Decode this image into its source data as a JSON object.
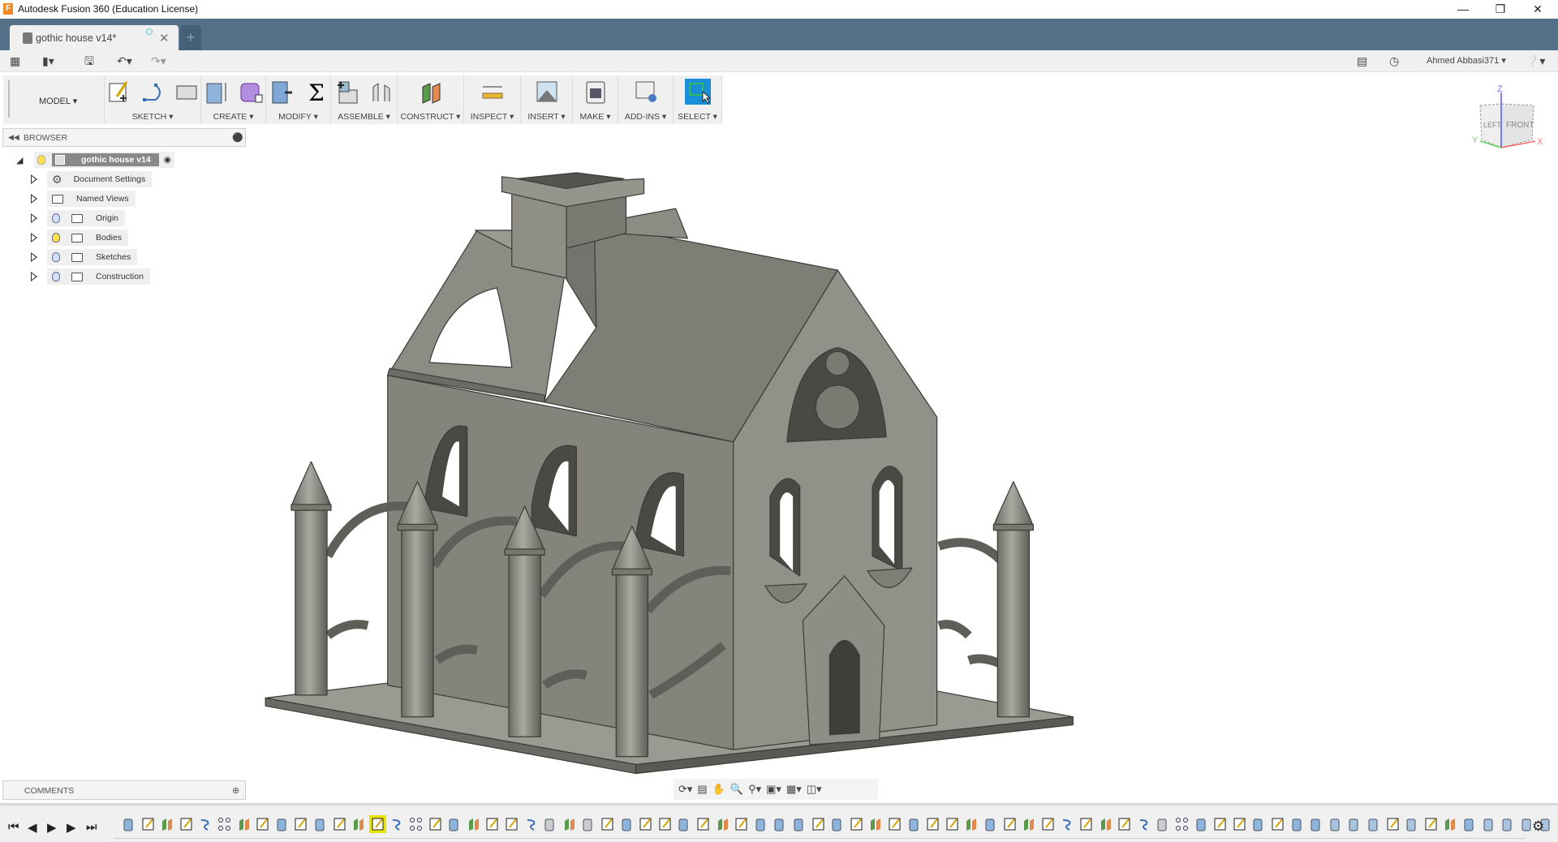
{
  "window": {
    "title": "Autodesk Fusion 360 (Education License)",
    "controls": [
      "minimize",
      "restore",
      "close"
    ]
  },
  "tabs": [
    {
      "label": "gothic house v14*",
      "active": true
    }
  ],
  "quickbar": {
    "user": "Ahmed Abbasi371",
    "icons": [
      "app-grid-icon",
      "file-icon",
      "save-icon",
      "undo-icon",
      "redo-icon",
      "comments-icon",
      "job-status-icon",
      "help-icon"
    ]
  },
  "ribbon": {
    "workspace": "MODEL",
    "groups": [
      {
        "label": "SKETCH",
        "icons": [
          "create-sketch-icon",
          "arc-icon",
          "rectangle-icon"
        ]
      },
      {
        "label": "CREATE",
        "icons": [
          "extrude-icon",
          "form-icon"
        ]
      },
      {
        "label": "MODIFY",
        "icons": [
          "press-pull-icon",
          "parameters-icon"
        ]
      },
      {
        "label": "ASSEMBLE",
        "icons": [
          "new-component-icon",
          "joint-icon"
        ]
      },
      {
        "label": "CONSTRUCT",
        "icons": [
          "offset-plane-icon"
        ]
      },
      {
        "label": "INSPECT",
        "icons": [
          "measure-icon"
        ]
      },
      {
        "label": "INSERT",
        "icons": [
          "insert-image-icon"
        ]
      },
      {
        "label": "MAKE",
        "icons": [
          "3d-print-icon"
        ]
      },
      {
        "label": "ADD-INS",
        "icons": [
          "scripts-icon"
        ]
      },
      {
        "label": "SELECT",
        "icons": [
          "select-icon"
        ]
      }
    ]
  },
  "browser": {
    "title": "BROWSER",
    "root": "gothic house v14",
    "items": [
      {
        "label": "Document Settings",
        "icon": "gear-icon",
        "bulb": null
      },
      {
        "label": "Named Views",
        "icon": "folder-icon",
        "bulb": null
      },
      {
        "label": "Origin",
        "icon": "folder-icon",
        "bulb": "off"
      },
      {
        "label": "Bodies",
        "icon": "folder-icon",
        "bulb": "on"
      },
      {
        "label": "Sketches",
        "icon": "folder-icon",
        "bulb": "off"
      },
      {
        "label": "Construction",
        "icon": "folder-icon",
        "bulb": "off"
      }
    ]
  },
  "comments": {
    "title": "COMMENTS"
  },
  "viewcube": {
    "left": "LEFT",
    "front": "FRONT",
    "x": "X",
    "y": "Y",
    "z": "Z"
  },
  "colors": {
    "tabbar": "#557189",
    "select_active": "#1a8fd8",
    "model": "#8a8a83",
    "highlight": "#e6e600"
  },
  "timeline": {
    "features": [
      "extrude",
      "sketch",
      "plane",
      "sketch",
      "revolve",
      "pattern",
      "plane",
      "sketch",
      "extrude",
      "sketch",
      "extrude",
      "sketch",
      "plane",
      "sketch",
      "revolve",
      "pattern",
      "sketch",
      "extrude",
      "plane",
      "sketch",
      "sketch",
      "revolve",
      "joint",
      "plane",
      "joint",
      "sketch",
      "extrude",
      "sketch",
      "sketch",
      "extrude",
      "sketch",
      "plane",
      "sketch",
      "extrude",
      "extrude",
      "extrude",
      "sketch",
      "extrude",
      "sketch",
      "plane",
      "sketch",
      "extrude",
      "sketch",
      "sketch",
      "plane",
      "extrude",
      "sketch",
      "plane",
      "sketch",
      "revolve",
      "sketch",
      "plane",
      "sketch",
      "revolve",
      "joint",
      "pattern",
      "extrude",
      "sketch",
      "sketch",
      "extrude",
      "sketch",
      "extrude",
      "extrude",
      "fillet",
      "fillet",
      "fillet",
      "sketch",
      "fillet",
      "sketch",
      "plane",
      "extrude",
      "fillet",
      "fillet",
      "fillet",
      "fillet"
    ],
    "selected_index": 13
  }
}
